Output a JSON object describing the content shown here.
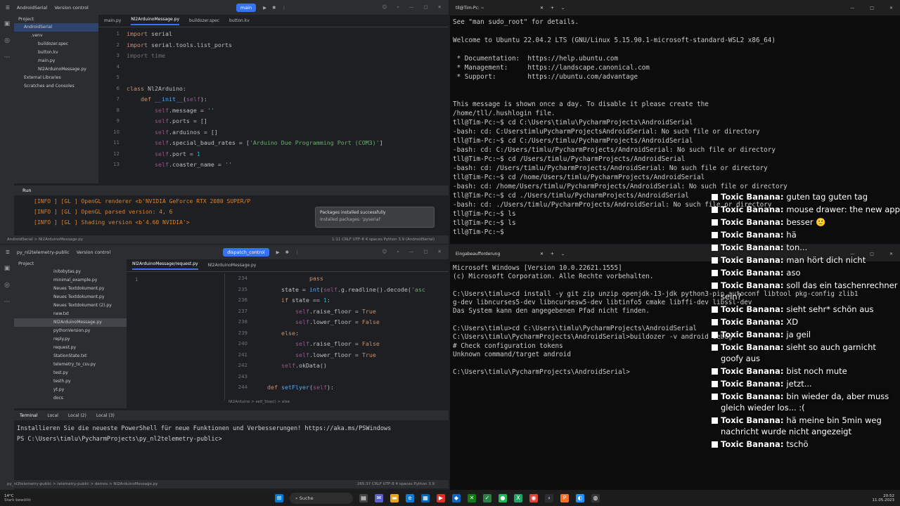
{
  "ide_top": {
    "project_name": "AndroidSerial",
    "vcs": "Version control",
    "branch": "main",
    "project_label": "Project",
    "tree": [
      {
        "label": "AndroidSerial",
        "indent": 1,
        "active": true
      },
      {
        "label": ".venv",
        "indent": 2
      },
      {
        "label": "buildozer.spec",
        "indent": 3
      },
      {
        "label": "button.kv",
        "indent": 3
      },
      {
        "label": "main.py",
        "indent": 3
      },
      {
        "label": "Nl2ArduinoMessage.py",
        "indent": 3
      },
      {
        "label": "External Libraries",
        "indent": 1
      },
      {
        "label": "Scratches and Consoles",
        "indent": 1
      }
    ],
    "tabs": [
      "main.py",
      "Nl2ArduinoMessage.py",
      "buildozer.spec",
      "button.kv"
    ],
    "active_tab": 1,
    "code_lines": [
      {
        "n": "1",
        "html": "<span class='kw'>import</span> serial"
      },
      {
        "n": "2",
        "html": "<span class='kw'>import</span> serial.tools.list_ports"
      },
      {
        "n": "3",
        "html": "<span class='dim'>import time</span>"
      },
      {
        "n": "4",
        "html": ""
      },
      {
        "n": "5",
        "html": ""
      },
      {
        "n": "6",
        "html": "<span class='kw'>class</span> Nl2Arduino:"
      },
      {
        "n": "7",
        "html": "    <span class='kw'>def</span> <span class='fn'>__init__</span>(<span class='self'>self</span>):"
      },
      {
        "n": "8",
        "html": "        <span class='self'>self</span>.message = <span class='str'>''</span>"
      },
      {
        "n": "9",
        "html": "        <span class='self'>self</span>.ports = []"
      },
      {
        "n": "10",
        "html": "        <span class='self'>self</span>.arduinos = []"
      },
      {
        "n": "11",
        "html": "        <span class='self'>self</span>.special_baud_rates = [<span class='str'>'Arduino Due Programming Port (COM3)'</span>]"
      },
      {
        "n": "12",
        "html": "        <span class='self'>self</span>.port = <span class='num'>1</span>"
      },
      {
        "n": "13",
        "html": "        <span class='self'>self</span>.coaster_name = <span class='str'>''</span>"
      }
    ],
    "run_label": "Run",
    "run_lines": [
      "[INFO   ] [GL          ] OpenGL renderer <b'NVIDIA GeForce RTX 2080 SUPER/P",
      "[INFO   ] [GL          ] OpenGL parsed version: 4, 6",
      "[INFO   ] [GL          ] Shading version <b'4.60 NVIDIA'>"
    ],
    "toast_title": "Packages installed successfully",
    "toast_body": "Installed packages: 'pyserial'",
    "status_path": "AndroidSerial > Nl2ArduinoMessage.py",
    "status_right": "1:11   CRLF   UTF-8   4 spaces   Python 3.9 (AndroidSerial)"
  },
  "ide_bottom": {
    "project_name": "py_nl2telemetry-public",
    "vcs": "Version control",
    "branch": "dispatch_control",
    "project_label": "Project",
    "tree": [
      "initobytas.py",
      "minimal_example.py",
      "Neues Textdokument.py",
      "Neues Textdokument.py",
      "Neues Textdokument (2).py",
      "new.txt",
      "Nl2ArduinoMessage.py",
      "pythonVersion.py",
      "reply.py",
      "request.py",
      "StationState.txt",
      "telemetry_to_csv.py",
      "test.py",
      "testh.py",
      "yt.py",
      "docs"
    ],
    "tabs": [
      "Nl2ArduinoMessage/request.py",
      "Nl2ArduinoMessage.py"
    ],
    "code_lines": [
      {
        "n": "234",
        "html": "                <span class='kw'>pass</span>"
      },
      {
        "n": "235",
        "html": "        state = <span class='fn'>int</span>(<span class='self'>self</span>.g.readline().decode(<span class='str'>'asc</span>"
      },
      {
        "n": "236",
        "html": "        <span class='kw'>if</span> state == <span class='num'>1</span>:"
      },
      {
        "n": "237",
        "html": "            <span class='self'>self</span>.raise_floor = <span class='kw'>True</span>"
      },
      {
        "n": "238",
        "html": "            <span class='self'>self</span>.lower_floor = <span class='kw'>False</span>"
      },
      {
        "n": "239",
        "html": "        <span class='kw'>else</span>:"
      },
      {
        "n": "240",
        "html": "            <span class='self'>self</span>.raise_floor = <span class='kw'>False</span>"
      },
      {
        "n": "241",
        "html": "            <span class='self'>self</span>.lower_floor = <span class='kw'>True</span>"
      },
      {
        "n": "242",
        "html": "        <span class='self'>self</span>.okData()"
      },
      {
        "n": "243",
        "html": ""
      },
      {
        "n": "244",
        "html": "    <span class='kw'>def</span> <span class='fn'>setFlyer</span>(<span class='self'>self</span>):"
      }
    ],
    "breadcrumb": "Nl2Arduino > self_Stop() > else",
    "terminal_tabs": [
      "Terminal",
      "Local",
      "Local (2)",
      "Local (3)"
    ],
    "terminal_lines": [
      "Installieren Sie die neueste PowerShell für neue Funktionen und Verbesserungen! https://aka.ms/PSWindows",
      "PS C:\\Users\\timlu\\PycharmProjects\\py_nl2telemetry-public> "
    ],
    "status_path": "py_nl2telemetry-public > telemetry-public > demos > Nl2ArduinoMessage.py",
    "status_right": "265:37   CRLF   UTF-8   4 spaces   Python 3.9"
  },
  "term_top": {
    "tab": "tll@Tim-Pc: ~",
    "lines": [
      "See \"man sudo_root\" for details.",
      "",
      "Welcome to Ubuntu 22.04.2 LTS (GNU/Linux 5.15.90.1-microsoft-standard-WSL2 x86_64)",
      "",
      " * Documentation:  https://help.ubuntu.com",
      " * Management:     https://landscape.canonical.com",
      " * Support:        https://ubuntu.com/advantage",
      "",
      "",
      "This message is shown once a day. To disable it please create the",
      "/home/tll/.hushlogin file.",
      "tll@Tim-Pc:~$ cd C:\\Users\\timlu\\PycharmProjects\\AndroidSerial",
      "-bash: cd: C:UserstimluPycharmProjectsAndroidSerial: No such file or directory",
      "tll@Tim-Pc:~$ cd C:/Users/timlu/PycharmProjects/AndroidSerial",
      "-bash: cd: C:/Users/timlu/PycharmProjects/AndroidSerial: No such file or directory",
      "tll@Tim-Pc:~$ cd /Users/timlu/PycharmProjects/AndroidSerial",
      "-bash: cd: /Users/timlu/PycharmProjects/AndroidSerial: No such file or directory",
      "tll@Tim-Pc:~$ cd /home/Users/timlu/PycharmProjects/AndroidSerial",
      "-bash: cd: /home/Users/timlu/PycharmProjects/AndroidSerial: No such file or directory",
      "tll@Tim-Pc:~$ cd ./Users/timlu/PycharmProjects/AndroidSerial",
      "-bash: cd: ./Users/timlu/PycharmProjects/AndroidSerial: No such file or directory",
      "tll@Tim-Pc:~$ ls",
      "tll@Tim-Pc:~$ ls",
      "tll@Tim-Pc:~$ "
    ]
  },
  "term_bottom": {
    "tab": "Eingabeaufforderung",
    "lines": [
      "Microsoft Windows [Version 10.0.22621.1555]",
      "(c) Microsoft Corporation. Alle Rechte vorbehalten.",
      "",
      "C:\\Users\\timlu>cd install -y git zip unzip openjdk-13-jdk python3-pip autoconf libtool pkg-config zlib1",
      "g-dev libncurses5-dev libncursesw5-dev libtinfo5 cmake libffi-dev libssl-dev",
      "Das System kann den angegebenen Pfad nicht finden.",
      "",
      "C:\\Users\\timlu>cd C:\\Users\\timlu\\PycharmProjects\\AndroidSerial",
      "C:\\Users\\timlu\\PycharmProjects\\AndroidSerial>buildozer -v android debug",
      "# Check configuration tokens",
      "Unknown command/target android",
      "",
      "C:\\Users\\timlu\\PycharmProjects\\AndroidSerial>"
    ]
  },
  "chat": {
    "user": "Toxic Banana:",
    "messages": [
      "guten tag guten tag",
      "mouse drawer: the new app",
      "besser 🙂",
      "hä",
      "ton...",
      "man hört dich nicht",
      "aso",
      "soll das ein taschenrechner sein?",
      "sieht sehr* schön aus",
      "XD",
      "ja geil",
      "sieht so auch garnicht goofy aus",
      "bist noch mute",
      "jetzt...",
      "bin wieder da, aber muss gleich wieder los... :(",
      "hä meine bin 5min weg nachricht wurde nicht angezeigt",
      "tschö"
    ]
  },
  "taskbar": {
    "weather_temp": "14°C",
    "weather_desc": "Stark bewölkt",
    "search": "Suche",
    "time": "20:52",
    "date": "11.05.2023"
  }
}
